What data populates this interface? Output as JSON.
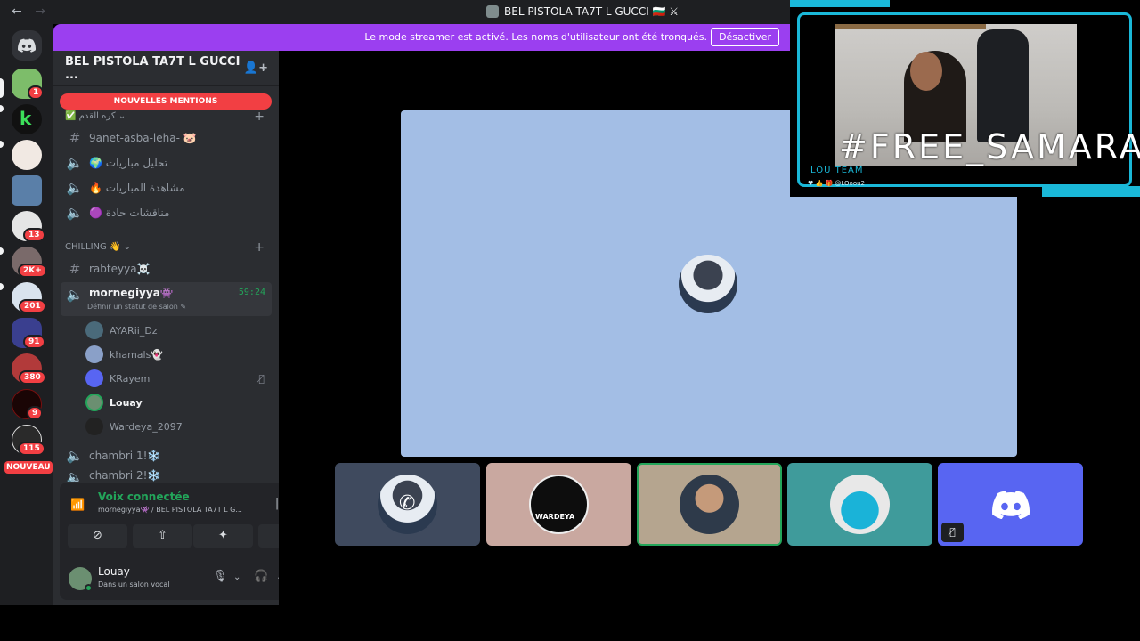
{
  "titlebar": {
    "back": "←",
    "forward": "→",
    "title": "BEL PISTOLA TA7T L GUCCI 🇧🇬 ⚔"
  },
  "banner": {
    "text": "Le mode streamer est activé. Les noms d'utilisateur ont été tronqués.",
    "button": "Désactiver"
  },
  "guilds": {
    "badges": [
      "1",
      "13",
      "2K+",
      "201",
      "91",
      "380",
      "9",
      "115"
    ],
    "new_label": "NOUVEAU"
  },
  "server": {
    "name": "BEL PISTOLA TA7T L GUCCI ...",
    "mentions": "NOUVELLES MENTIONS",
    "category1": "✅ كره القدم ⌄",
    "channels": [
      {
        "name": "9anet-asba-leha- 🐷",
        "type": "text"
      },
      {
        "name": "🌍 تحليل مباريات",
        "type": "voice"
      },
      {
        "name": "🔥 مشاهدة المباريات",
        "type": "voice"
      },
      {
        "name": "🟣 مناقشات حادة",
        "type": "voice"
      }
    ],
    "category2": "CHILLING 👋 ⌄",
    "channel_rabteyya": "rabteyya☠️",
    "active_channel": {
      "name": "mornegiyya👾",
      "time": "59:24",
      "status": "Définir un statut de salon ✎"
    },
    "voice_users": [
      {
        "name": "AYARii_Dz"
      },
      {
        "name": "khamals👻"
      },
      {
        "name": "KRayem"
      },
      {
        "name": "Louay"
      },
      {
        "name": "Wardeya_2097"
      }
    ],
    "channel_chambri1": "chambri 1!❄️",
    "channel_chambri2": "chambri 2!❄️"
  },
  "voice_panel": {
    "title": "Voix connectée",
    "subtitle": "mornegiyya👾 / BEL PISTOLA TA7T L G..."
  },
  "user_panel": {
    "name": "Louay",
    "status": "Dans un salon vocal"
  },
  "stream": {
    "overlay_tag": "#FREE_SAMARA",
    "team": "LOU TEAM",
    "handle": "♥ 👍 🎁 @LOoou2",
    "tile_label": "WARDEYA"
  },
  "colors": {
    "accent": "#9b3ff0",
    "danger": "#f23f43",
    "online": "#23a55a",
    "blurple": "#5865f2",
    "screen_bg": "#a3bee5"
  }
}
